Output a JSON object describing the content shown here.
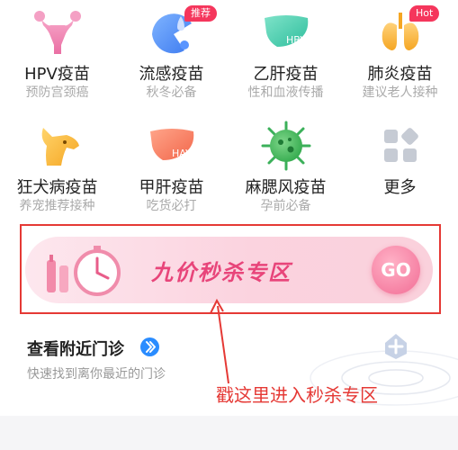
{
  "grid": [
    {
      "label": "HPV疫苗",
      "sub": "预防宫颈癌",
      "icon": "uterus-icon",
      "badge": ""
    },
    {
      "label": "流感疫苗",
      "sub": "秋冬必备",
      "icon": "flu-icon",
      "badge": "推荐"
    },
    {
      "label": "乙肝疫苗",
      "sub": "性和血液传播",
      "icon": "liver-hbv-icon",
      "badge": ""
    },
    {
      "label": "肺炎疫苗",
      "sub": "建议老人接种",
      "icon": "lungs-icon",
      "badge": "Hot"
    },
    {
      "label": "狂犬病疫苗",
      "sub": "养宠推荐接种",
      "icon": "dog-icon",
      "badge": ""
    },
    {
      "label": "甲肝疫苗",
      "sub": "吃货必打",
      "icon": "liver-hav-icon",
      "badge": ""
    },
    {
      "label": "麻腮风疫苗",
      "sub": "孕前必备",
      "icon": "virus-icon",
      "badge": ""
    },
    {
      "label": "更多",
      "sub": "",
      "icon": "more-grid-icon",
      "badge": ""
    }
  ],
  "icon_text": {
    "hbv": "HBV",
    "hav": "HAV"
  },
  "banner": {
    "title": "九价秒杀专区",
    "go": "GO"
  },
  "nearby": {
    "title": "查看附近门诊",
    "subtitle": "快速找到离你最近的门诊"
  },
  "annotation": {
    "text": "戳这里进入秒杀专区"
  },
  "colors": {
    "accent_red": "#e53935",
    "banner_pink": "#e8457a",
    "badge_red": "#f5365c",
    "link_blue": "#2a8cff"
  }
}
